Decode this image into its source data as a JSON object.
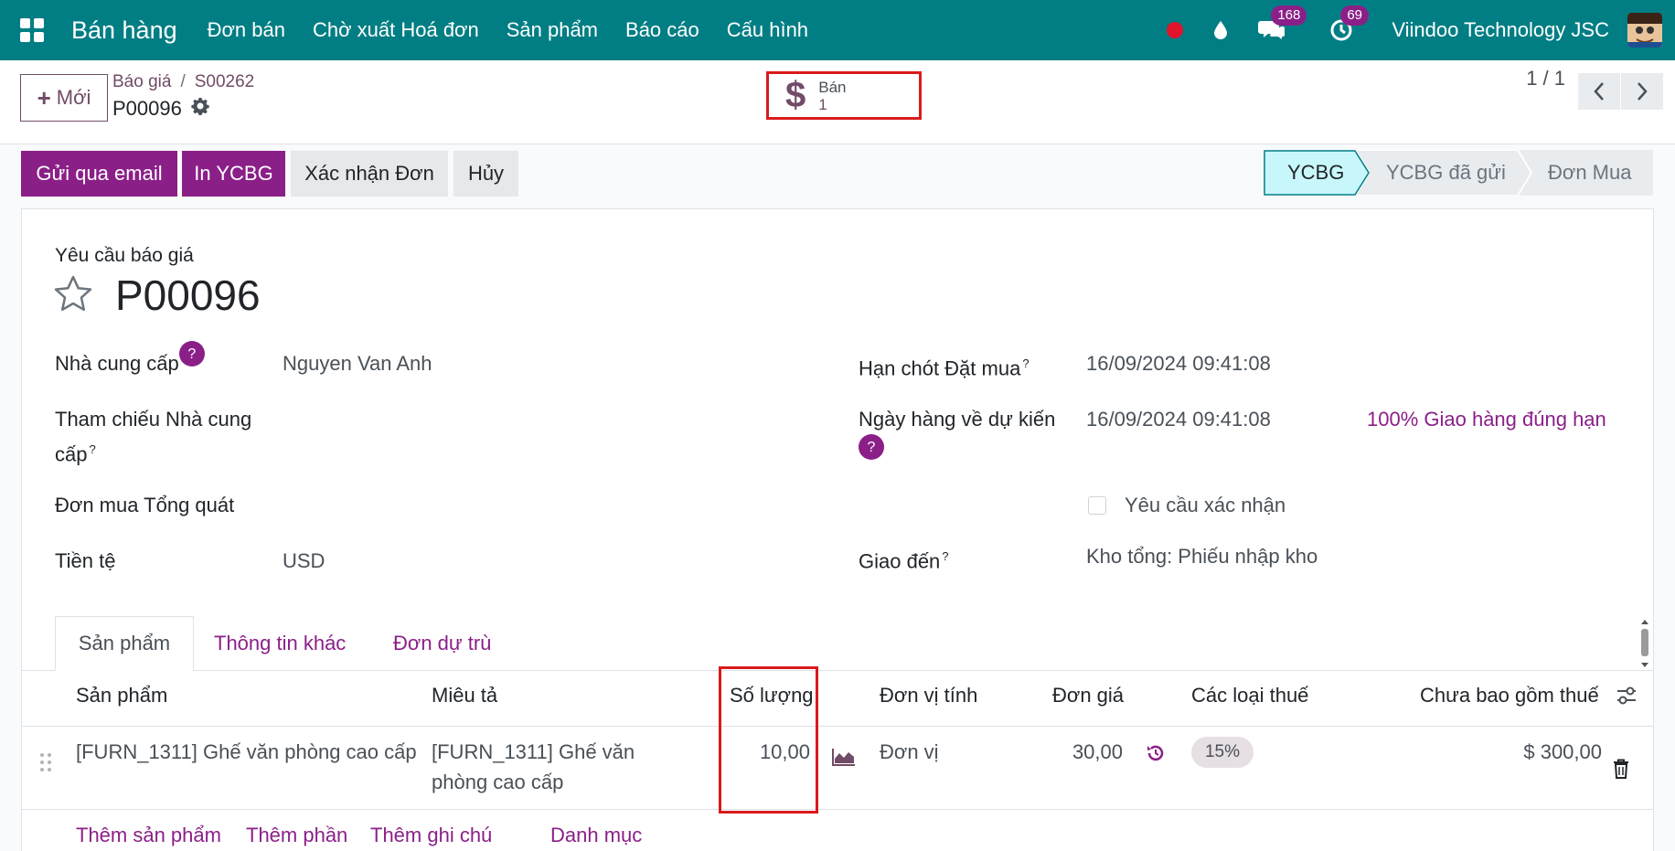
{
  "navbar": {
    "app_name": "Bán hàng",
    "menu": [
      "Đơn bán",
      "Chờ xuất Hoá đơn",
      "Sản phẩm",
      "Báo cáo",
      "Cấu hình"
    ],
    "messages_count": "168",
    "activities_count": "69",
    "company": "Viindoo Technology JSC",
    "colors": {
      "bar": "#017e84",
      "badge": "#8b1f88",
      "record": "#e0142c"
    }
  },
  "control_panel": {
    "new_button": "Mới",
    "breadcrumb": [
      "Báo giá",
      "S00262"
    ],
    "record_name": "P00096",
    "smart_button": {
      "label": "Bán",
      "value": "1"
    },
    "pager": "1 / 1"
  },
  "actions": {
    "buttons": [
      "Gửi qua email",
      "In YCBG",
      "Xác nhận Đơn",
      "Hủy"
    ]
  },
  "statusbar": {
    "stages": [
      "YCBG",
      "YCBG đã gửi",
      "Đơn Mua"
    ],
    "active_stage": "YCBG"
  },
  "form": {
    "doc_type": "Yêu cầu báo giá",
    "doc_name": "P00096",
    "left_fields": [
      {
        "label": "Nhà cung cấp",
        "value": "Nguyen Van Anh"
      },
      {
        "label_line1": "Tham chiếu Nhà cung",
        "label_line2": "cấp",
        "value": ""
      },
      {
        "label": "Đơn mua Tổng quát",
        "value": ""
      },
      {
        "label": "Tiền tệ",
        "value": "USD"
      }
    ],
    "right_fields": [
      {
        "label": "Hạn chót Đặt mua",
        "value": "16/09/2024 09:41:08"
      },
      {
        "label": "Ngày hàng về dự kiến",
        "value": "16/09/2024 09:41:08",
        "extra": "100% Giao hàng đúng hạn"
      },
      {
        "label": "",
        "checkbox_label": "Yêu cầu xác nhận"
      },
      {
        "label": "Giao đến",
        "value": "Kho tổng: Phiếu nhập kho"
      }
    ]
  },
  "tabs": [
    "Sản phẩm",
    "Thông tin khác",
    "Đơn dự trù"
  ],
  "table": {
    "headers": [
      "Sản phẩm",
      "Miêu tả",
      "Số lượng",
      "Đơn vị tính",
      "Đơn giá",
      "Các loại thuế",
      "Chưa bao gồm thuế"
    ],
    "rows": [
      {
        "product": "[FURN_1311] Ghế văn phòng cao cấp",
        "desc_line1": "[FURN_1311] Ghế văn",
        "desc_line2": "phòng cao cấp",
        "qty": "10,00",
        "uom": "Đơn vị",
        "price": "30,00",
        "tax": "15%",
        "subtotal": "$ 300,00"
      }
    ],
    "footer_links": [
      "Thêm sản phẩm",
      "Thêm phần",
      "Thêm ghi chú",
      "Danh mục"
    ]
  }
}
